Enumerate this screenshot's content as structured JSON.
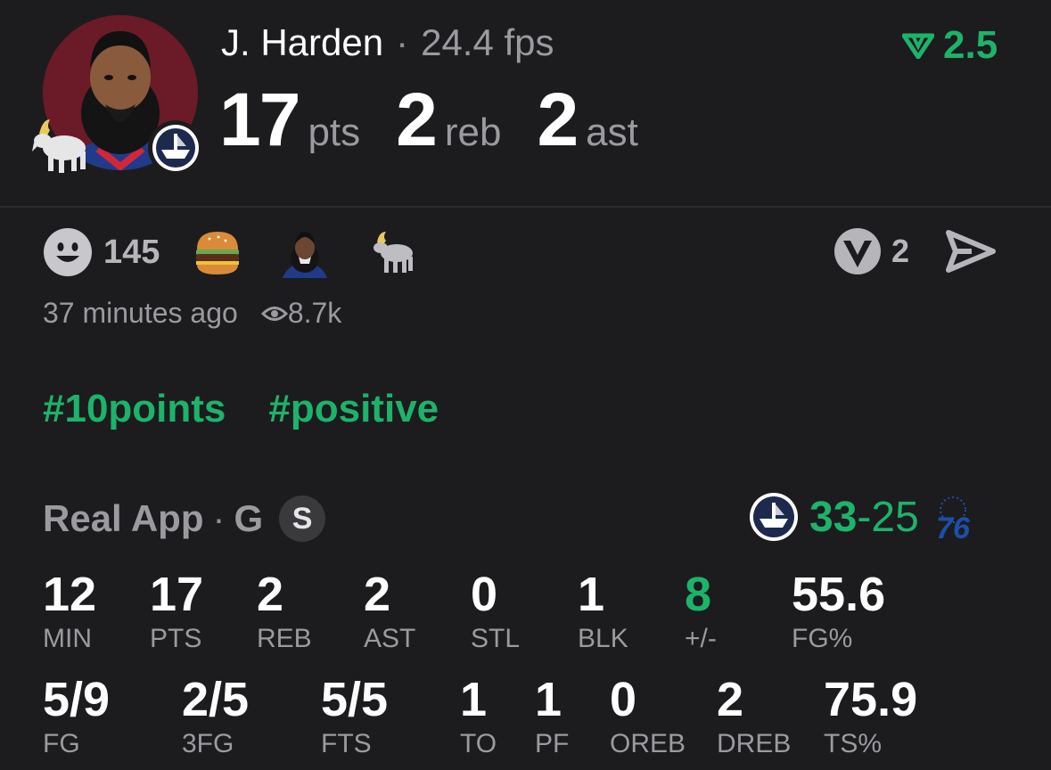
{
  "player": {
    "name": "J. Harden",
    "fps": "24.4 fps",
    "pts": "17",
    "pts_label": "pts",
    "reb": "2",
    "reb_label": "reb",
    "ast": "2",
    "ast_label": "ast",
    "rating": "2.5"
  },
  "social": {
    "reaction_count": "145",
    "reactions": [
      "smiley-face-icon",
      "hamburger-emoji",
      "bearded-face-emoji",
      "goat-emoji"
    ],
    "realapp_count": "2",
    "time_ago": "37 minutes ago",
    "views": "8.7k"
  },
  "tags": [
    "#10points",
    "#positive"
  ],
  "game": {
    "source": "Real App",
    "position": "G",
    "badge": "S",
    "team_score": "33",
    "opp_score": "25",
    "opp_logo_text": "76"
  },
  "stats": {
    "row1": [
      {
        "value": "12",
        "label": "MIN"
      },
      {
        "value": "17",
        "label": "PTS"
      },
      {
        "value": "2",
        "label": "REB"
      },
      {
        "value": "2",
        "label": "AST"
      },
      {
        "value": "0",
        "label": "STL"
      },
      {
        "value": "1",
        "label": "BLK"
      },
      {
        "value": "8",
        "label": "+/-"
      },
      {
        "value": "55.6",
        "label": "FG%"
      }
    ],
    "row2": [
      {
        "value": "5/9",
        "label": "FG"
      },
      {
        "value": "2/5",
        "label": "3FG"
      },
      {
        "value": "5/5",
        "label": "FTS"
      },
      {
        "value": "1",
        "label": "TO"
      },
      {
        "value": "1",
        "label": "PF"
      },
      {
        "value": "0",
        "label": "OREB"
      },
      {
        "value": "2",
        "label": "DREB"
      },
      {
        "value": "75.9",
        "label": "TS%"
      }
    ]
  },
  "colors": {
    "accent": "#1db36a",
    "background": "#1c1c1e",
    "muted": "#9a9a9f"
  }
}
